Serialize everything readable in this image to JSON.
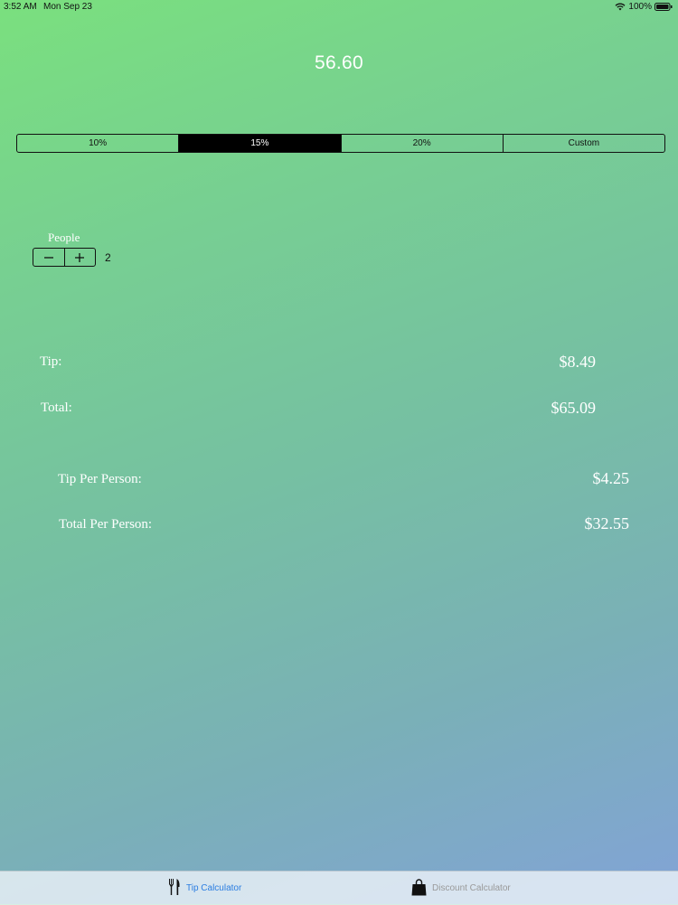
{
  "status_bar": {
    "time": "3:52 AM",
    "date": "Mon Sep 23",
    "battery": "100%"
  },
  "bill": {
    "amount": "56.60"
  },
  "tip_options": [
    {
      "label": "10%",
      "selected": false
    },
    {
      "label": "15%",
      "selected": true
    },
    {
      "label": "20%",
      "selected": false
    },
    {
      "label": "Custom",
      "selected": false
    }
  ],
  "people": {
    "label": "People",
    "count": "2",
    "decrement_icon": "minus-icon",
    "increment_icon": "plus-icon"
  },
  "results": {
    "tip_label": "Tip:",
    "tip_value": "$8.49",
    "total_label": "Total:",
    "total_value": "$65.09",
    "tip_per_person_label": "Tip Per Person:",
    "tip_per_person_value": "$4.25",
    "total_per_person_label": "Total Per Person:",
    "total_per_person_value": "$32.55"
  },
  "tab_bar": {
    "tabs": [
      {
        "label": "Tip Calculator",
        "icon": "fork-knife-icon",
        "selected": true
      },
      {
        "label": "Discount Calculator",
        "icon": "shopping-bag-icon",
        "selected": false
      }
    ]
  },
  "colors": {
    "gradient_start": "#7ae07e",
    "gradient_end": "#82a3d7",
    "active_tab": "#2b7de1",
    "inactive_tab": "#999999"
  }
}
